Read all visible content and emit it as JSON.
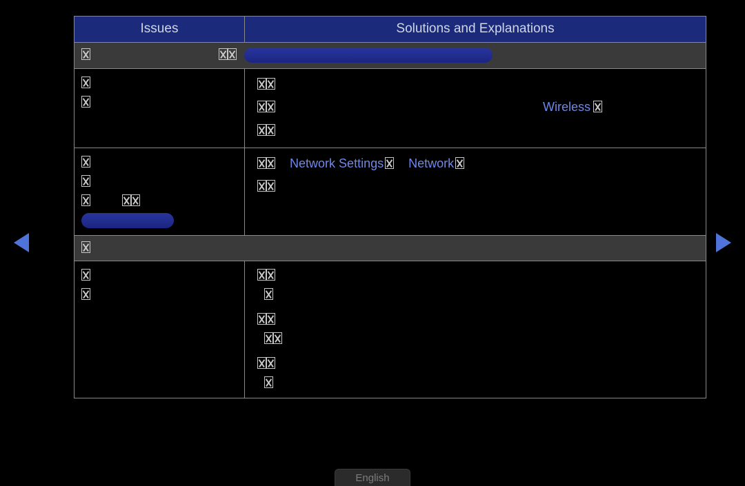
{
  "header": {
    "issues": "Issues",
    "solutions": "Solutions and Explanations"
  },
  "section1": {
    "title_prefix": "",
    "title_rest": ""
  },
  "row1": {
    "issue_l1": "",
    "issue_l2": "",
    "sol_l1": "",
    "sol_l2a": "",
    "sol_l2_link": "Wireless",
    "sol_l2b": "",
    "sol_l3": ""
  },
  "row2": {
    "issue_l1": "",
    "issue_l2": "",
    "issue_l3a": "",
    "issue_l3b": "",
    "sol_l1a": "",
    "sol_l1_link1": "Network Settings",
    "sol_l1_mid": "",
    "sol_l1_link2": "Network",
    "sol_l1b": "",
    "sol_l2": ""
  },
  "section2": {
    "title": ""
  },
  "row3": {
    "issue_l1": "",
    "issue_l2": "",
    "sol_l1": "",
    "sol_l2": "",
    "sol_l3": "",
    "sol_l4": "",
    "sol_l5": "",
    "sol_l6": ""
  },
  "footer": {
    "language": "English"
  }
}
